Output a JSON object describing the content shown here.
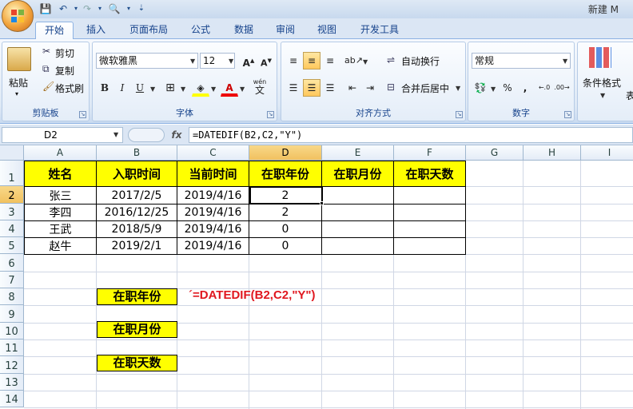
{
  "titlebar": {
    "app_title": "新建 M"
  },
  "tabs": [
    {
      "label": "开始",
      "active": true
    },
    {
      "label": "插入"
    },
    {
      "label": "页面布局"
    },
    {
      "label": "公式"
    },
    {
      "label": "数据"
    },
    {
      "label": "审阅"
    },
    {
      "label": "视图"
    },
    {
      "label": "开发工具"
    }
  ],
  "ribbon": {
    "clipboard": {
      "label": "剪贴板",
      "paste": "粘贴",
      "cut": "剪切",
      "copy": "复制",
      "format_painter": "格式刷"
    },
    "font": {
      "label": "字体",
      "name": "微软雅黑",
      "size": "12",
      "bold": "B",
      "italic": "I",
      "underline": "U",
      "wen": "wén",
      "wen_char": "文"
    },
    "alignment": {
      "label": "对齐方式",
      "wrap": "自动换行",
      "merge": "合并后居中"
    },
    "number": {
      "label": "数字",
      "format": "常规",
      "percent": "%",
      "comma": ","
    },
    "styles": {
      "conditional": "条件格式",
      "table_partial": "表"
    }
  },
  "formula_bar": {
    "name_box": "D2",
    "fx": "fx",
    "formula": "=DATEDIF(B2,C2,\"Y\")"
  },
  "columns": [
    "A",
    "B",
    "C",
    "D",
    "E",
    "F",
    "G",
    "H",
    "I"
  ],
  "rows": [
    "1",
    "2",
    "3",
    "4",
    "5",
    "6",
    "7",
    "8",
    "9",
    "10",
    "11",
    "12",
    "13",
    "14"
  ],
  "table": {
    "headers": [
      "姓名",
      "入职时间",
      "当前时间",
      "在职年份",
      "在职月份",
      "在职天数"
    ],
    "rows": [
      [
        "张三",
        "2017/2/5",
        "2019/4/16",
        "2",
        "",
        ""
      ],
      [
        "李四",
        "2016/12/25",
        "2019/4/16",
        "2",
        "",
        ""
      ],
      [
        "王武",
        "2018/5/9",
        "2019/4/16",
        "0",
        "",
        ""
      ],
      [
        "赵牛",
        "2019/2/1",
        "2019/4/16",
        "0",
        "",
        ""
      ]
    ]
  },
  "labels": {
    "years": "在职年份",
    "months": "在职月份",
    "days": "在职天数"
  },
  "note_formula": "´=DATEDIF(B2,C2,\"Y\")",
  "colors": {
    "header_fill": "#ffff00",
    "note_red": "#e0171f",
    "selection": "#f1c15f"
  }
}
